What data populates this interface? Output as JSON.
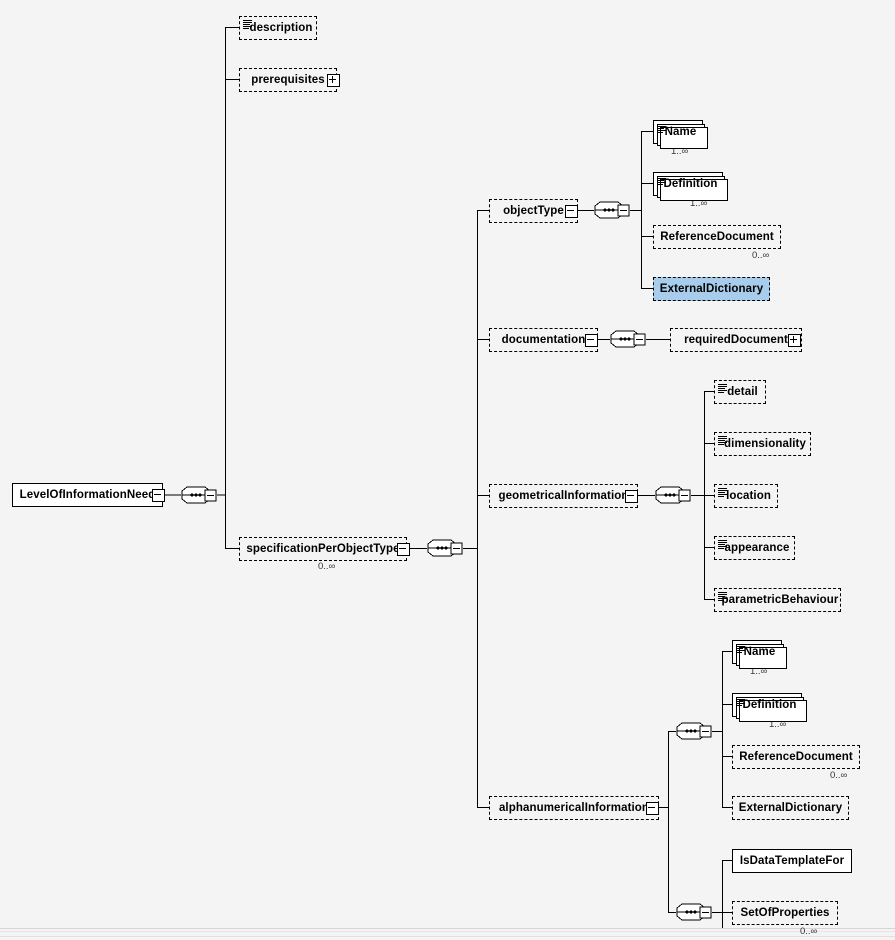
{
  "diagram": {
    "title": "LevelOfInformationNeed",
    "type": "xsd-schema-tree",
    "background_color": "#f4f4f4",
    "highlight_color": "#a8cdec",
    "infinity": "∞"
  },
  "root": {
    "label": "LevelOfInformationNeed",
    "style": "solid",
    "expander": "minus"
  },
  "nodes": {
    "description": {
      "label": "description",
      "style": "dashed",
      "icon": "document-icon",
      "cardinality": ""
    },
    "prerequisites": {
      "label": "prerequisites",
      "style": "dashed",
      "expander": "plus",
      "cardinality": ""
    },
    "specification_per_object_type": {
      "label": "specificationPerObjectType",
      "style": "dashed",
      "expander": "minus",
      "cardinality": "0..∞"
    },
    "object_type": {
      "label": "objectType",
      "style": "dashed",
      "expander": "minus",
      "cardinality": ""
    },
    "ot_name": {
      "label": "Name",
      "style": "solid",
      "icon": "document-icon",
      "stacked": true,
      "cardinality": "1..∞"
    },
    "ot_definition": {
      "label": "Definition",
      "style": "solid",
      "icon": "document-icon",
      "stacked": true,
      "cardinality": "1..∞"
    },
    "ot_reference_document": {
      "label": "ReferenceDocument",
      "style": "dashed",
      "cardinality": "0..∞"
    },
    "ot_external_dictionary": {
      "label": "ExternalDictionary",
      "style": "highlight",
      "cardinality": ""
    },
    "documentation": {
      "label": "documentation",
      "style": "dashed",
      "expander": "minus",
      "cardinality": ""
    },
    "required_document": {
      "label": "requiredDocument",
      "style": "dashed",
      "expander": "plus",
      "cardinality": ""
    },
    "geometrical_information": {
      "label": "geometricalInformation",
      "style": "dashed",
      "expander": "minus",
      "cardinality": ""
    },
    "gi_detail": {
      "label": "detail",
      "style": "dashed",
      "icon": "document-icon",
      "cardinality": ""
    },
    "gi_dimensionality": {
      "label": "dimensionality",
      "style": "dashed",
      "icon": "document-icon",
      "cardinality": ""
    },
    "gi_location": {
      "label": "location",
      "style": "dashed",
      "icon": "document-icon",
      "cardinality": ""
    },
    "gi_appearance": {
      "label": "appearance",
      "style": "dashed",
      "icon": "document-icon",
      "cardinality": ""
    },
    "gi_parametric_behaviour": {
      "label": "parametricBehaviour",
      "style": "dashed",
      "icon": "document-icon",
      "cardinality": ""
    },
    "alphanumerical_information": {
      "label": "alphanumericalInformation",
      "style": "dashed",
      "expander": "minus",
      "cardinality": ""
    },
    "ai_name": {
      "label": "Name",
      "style": "solid",
      "icon": "document-icon",
      "stacked": true,
      "cardinality": "1..∞"
    },
    "ai_definition": {
      "label": "Definition",
      "style": "solid",
      "icon": "document-icon",
      "stacked": true,
      "cardinality": "1..∞"
    },
    "ai_reference_document": {
      "label": "ReferenceDocument",
      "style": "dashed",
      "cardinality": "0..∞"
    },
    "ai_external_dictionary": {
      "label": "ExternalDictionary",
      "style": "dashed",
      "cardinality": ""
    },
    "ai_is_data_template_for": {
      "label": "IsDataTemplateFor",
      "style": "solid",
      "cardinality": ""
    },
    "ai_set_of_properties": {
      "label": "SetOfProperties",
      "style": "dashed",
      "cardinality": "0..∞"
    }
  }
}
